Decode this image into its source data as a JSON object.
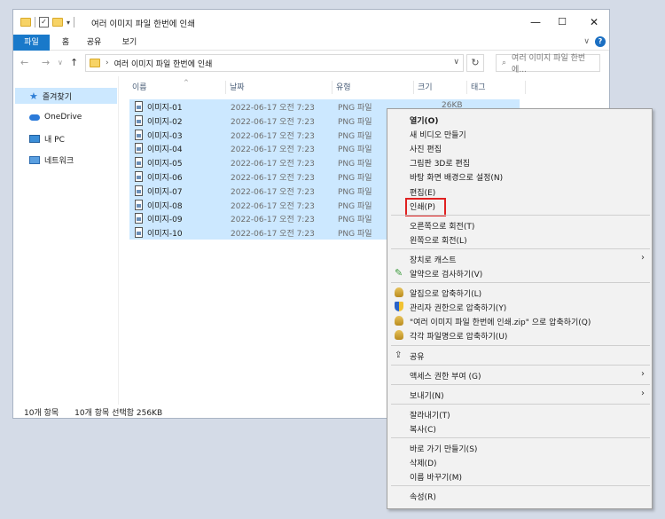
{
  "window": {
    "title": "여러 이미지 파일 한번에 인쇄",
    "minimize": "—",
    "maximize": "☐",
    "close": "✕"
  },
  "ribbon": {
    "tabs": [
      "파일",
      "홈",
      "공유",
      "보기"
    ],
    "expand": "∨",
    "help": "?"
  },
  "address": {
    "path": "여러 이미지 파일 한번에 인쇄",
    "back": "←",
    "forward": "→",
    "dropdown": "∨",
    "up": "↑",
    "refresh": "↻",
    "search_placeholder": "여러 이미지 파일 한번에..."
  },
  "navpane": {
    "items": [
      "즐겨찾기",
      "OneDrive",
      "내 PC",
      "네트워크"
    ]
  },
  "columns": [
    "이름",
    "날짜",
    "유형",
    "크기",
    "태그"
  ],
  "files": [
    {
      "name": "이미지-01",
      "date": "2022-06-17 오전 7:23",
      "type": "PNG 파일",
      "size": "26KB"
    },
    {
      "name": "이미지-02",
      "date": "2022-06-17 오전 7:23",
      "type": "PNG 파일",
      "size": ""
    },
    {
      "name": "이미지-03",
      "date": "2022-06-17 오전 7:23",
      "type": "PNG 파일",
      "size": ""
    },
    {
      "name": "이미지-04",
      "date": "2022-06-17 오전 7:23",
      "type": "PNG 파일",
      "size": ""
    },
    {
      "name": "이미지-05",
      "date": "2022-06-17 오전 7:23",
      "type": "PNG 파일",
      "size": ""
    },
    {
      "name": "이미지-06",
      "date": "2022-06-17 오전 7:23",
      "type": "PNG 파일",
      "size": ""
    },
    {
      "name": "이미지-07",
      "date": "2022-06-17 오전 7:23",
      "type": "PNG 파일",
      "size": ""
    },
    {
      "name": "이미지-08",
      "date": "2022-06-17 오전 7:23",
      "type": "PNG 파일",
      "size": ""
    },
    {
      "name": "이미지-09",
      "date": "2022-06-17 오전 7:23",
      "type": "PNG 파일",
      "size": ""
    },
    {
      "name": "이미지-10",
      "date": "2022-06-17 오전 7:23",
      "type": "PNG 파일",
      "size": ""
    }
  ],
  "status": {
    "count": "10개 항목",
    "selected": "10개 항목 선택함 256KB"
  },
  "context_menu": {
    "groups": [
      [
        "열기(O)",
        "새 비디오 만들기",
        "사진 편집",
        "그림판 3D로 편집",
        "바탕 화면 배경으로 설정(N)",
        "편집(E)",
        "인쇄(P)"
      ],
      [
        "오른쪽으로 회전(T)",
        "왼쪽으로 회전(L)"
      ],
      [
        "장치로 캐스트",
        "알약으로 검사하기(V)"
      ],
      [
        "알집으로 압축하기(L)",
        "관리자 권한으로 압축하기(Y)",
        "\"여러 이미지 파일 한번에 인쇄.zip\" 으로 압축하기(Q)",
        "각각 파일명으로 압축하기(U)"
      ],
      [
        "공유"
      ],
      [
        "액세스 권한 부여 (G)"
      ],
      [
        "보내기(N)"
      ],
      [
        "잘라내기(T)",
        "복사(C)"
      ],
      [
        "바로 가기 만들기(S)",
        "삭제(D)",
        "이름 바꾸기(M)"
      ],
      [
        "속성(R)"
      ]
    ],
    "submenu_arrow": "›",
    "highlighted_item": "인쇄(P)",
    "highlight_color": "#e02121"
  }
}
